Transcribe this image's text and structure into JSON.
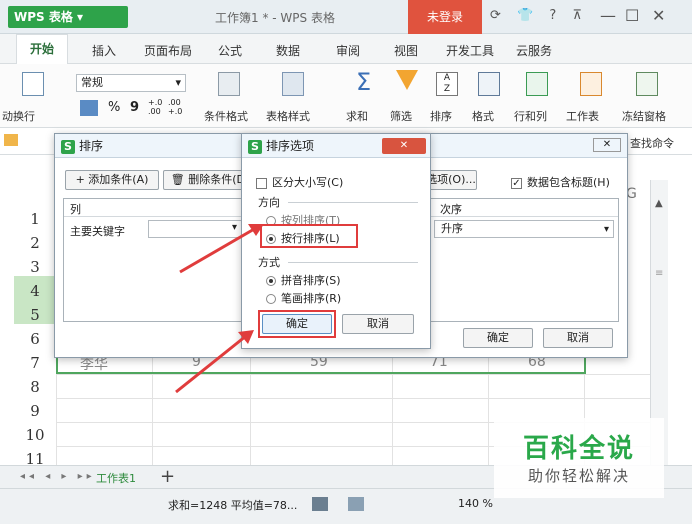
{
  "app": {
    "button_label": "WPS 表格",
    "doc_title": "工作簿1 * - WPS 表格",
    "login": "未登录"
  },
  "tabs": [
    "开始",
    "插入",
    "页面布局",
    "公式",
    "数据",
    "审阅",
    "视图",
    "开发工具",
    "云服务"
  ],
  "ribbon": {
    "wrap": "动换行",
    "format_select": "常规",
    "percent": "%",
    "comma": "9",
    "cond_format": "条件格式",
    "table_style": "表格样式",
    "sum": "求和",
    "filter": "筛选",
    "sort": "排序",
    "format": "格式",
    "row_col": "行和列",
    "worksheet": "工作表",
    "freeze": "冻结窗格",
    "find_cmd": "查找命令"
  },
  "sheet": {
    "rows": [
      "1",
      "2",
      "3",
      "4",
      "5",
      "6",
      "7",
      "8",
      "9",
      "10",
      "11"
    ],
    "row7_values": [
      "李华",
      "9",
      "59",
      "71",
      "68"
    ],
    "col_letter": "G"
  },
  "sort_dialog": {
    "title": "排序",
    "add_condition": "添加条件(A)",
    "delete_condition": "删除条件(D)",
    "options": "选项(O)...",
    "has_header": "数据包含标题(H)",
    "col_header": "列",
    "order_header": "次序",
    "primary_key": "主要关键字",
    "order_value": "升序",
    "ok": "确定",
    "cancel": "取消"
  },
  "options_dialog": {
    "title": "排序选项",
    "case_sensitive": "区分大小写(C)",
    "direction_label": "方向",
    "by_column": "按列排序(T)",
    "by_row": "按行排序(L)",
    "method_label": "方式",
    "pinyin": "拼音排序(S)",
    "stroke": "笔画排序(R)",
    "ok": "确定",
    "cancel": "取消"
  },
  "sheet_tab": "工作表1",
  "status": {
    "sum_avg": "求和=1248  平均值=78...",
    "zoom": "140 %"
  },
  "watermark": {
    "title": "百科全说",
    "sub": "助你轻松解决"
  },
  "colors": {
    "accent": "#2ea34a",
    "login": "#e0533e",
    "highlight": "#e03c3c"
  }
}
